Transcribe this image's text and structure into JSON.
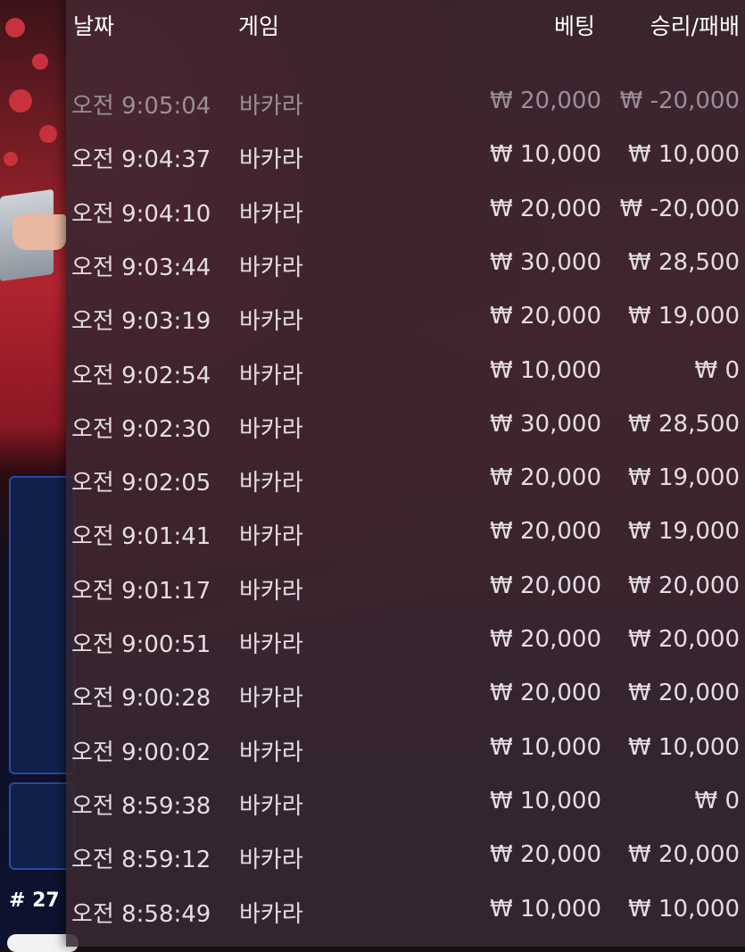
{
  "header": {
    "date": "날짜",
    "game": "게임",
    "bet": "베팅",
    "result": "승리/패배"
  },
  "rows": [
    {
      "time": "오전 9:05:04",
      "game": "바카라",
      "bet": "₩ 20,000",
      "result": "₩ -20,000",
      "faded": true
    },
    {
      "time": "오전 9:04:37",
      "game": "바카라",
      "bet": "₩ 10,000",
      "result": "₩ 10,000"
    },
    {
      "time": "오전 9:04:10",
      "game": "바카라",
      "bet": "₩ 20,000",
      "result": "₩ -20,000"
    },
    {
      "time": "오전 9:03:44",
      "game": "바카라",
      "bet": "₩ 30,000",
      "result": "₩ 28,500"
    },
    {
      "time": "오전 9:03:19",
      "game": "바카라",
      "bet": "₩ 20,000",
      "result": "₩ 19,000"
    },
    {
      "time": "오전 9:02:54",
      "game": "바카라",
      "bet": "₩ 10,000",
      "result": "₩ 0"
    },
    {
      "time": "오전 9:02:30",
      "game": "바카라",
      "bet": "₩ 30,000",
      "result": "₩ 28,500"
    },
    {
      "time": "오전 9:02:05",
      "game": "바카라",
      "bet": "₩ 20,000",
      "result": "₩ 19,000"
    },
    {
      "time": "오전 9:01:41",
      "game": "바카라",
      "bet": "₩ 20,000",
      "result": "₩ 19,000"
    },
    {
      "time": "오전 9:01:17",
      "game": "바카라",
      "bet": "₩ 20,000",
      "result": "₩ 20,000"
    },
    {
      "time": "오전 9:00:51",
      "game": "바카라",
      "bet": "₩ 20,000",
      "result": "₩ 20,000"
    },
    {
      "time": "오전 9:00:28",
      "game": "바카라",
      "bet": "₩ 20,000",
      "result": "₩ 20,000"
    },
    {
      "time": "오전 9:00:02",
      "game": "바카라",
      "bet": "₩ 10,000",
      "result": "₩ 10,000"
    },
    {
      "time": "오전 8:59:38",
      "game": "바카라",
      "bet": "₩ 10,000",
      "result": "₩ 0"
    },
    {
      "time": "오전 8:59:12",
      "game": "바카라",
      "bet": "₩ 20,000",
      "result": "₩ 20,000"
    },
    {
      "time": "오전 8:58:49",
      "game": "바카라",
      "bet": "₩ 10,000",
      "result": "₩ 10,000"
    }
  ],
  "round_label": "# 27"
}
